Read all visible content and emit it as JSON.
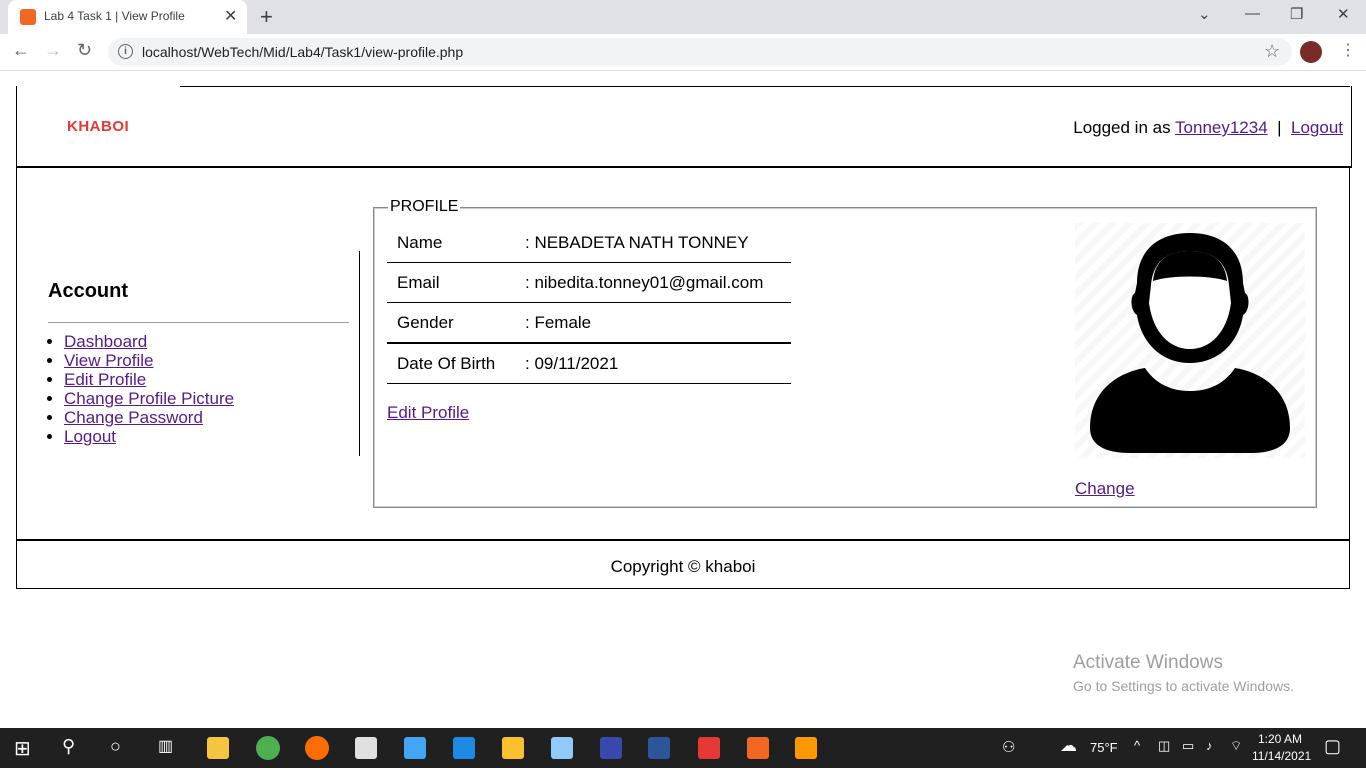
{
  "browser": {
    "tab_title": "Lab 4 Task 1 | View Profile",
    "url": "localhost/WebTech/Mid/Lab4/Task1/view-profile.php"
  },
  "header": {
    "logo": "KHABOI",
    "logged_in_prefix": "Logged in as",
    "username": "Tonney1234",
    "separator": "|",
    "logout": "Logout"
  },
  "sidebar": {
    "title": "Account",
    "items": [
      {
        "label": "Dashboard"
      },
      {
        "label": "View Profile"
      },
      {
        "label": "Edit Profile"
      },
      {
        "label": "Change Profile Picture"
      },
      {
        "label": "Change Password"
      },
      {
        "label": "Logout"
      }
    ]
  },
  "profile": {
    "legend": "PROFILE",
    "rows": [
      {
        "label": "Name",
        "value": ": NEBADETA NATH TONNEY"
      },
      {
        "label": "Email",
        "value": ": nibedita.tonney01@gmail.com"
      },
      {
        "label": "Gender",
        "value": ": Female"
      },
      {
        "label": "Date Of Birth",
        "value": ": 09/11/2021"
      }
    ],
    "edit_link": "Edit Profile",
    "change_link": "Change"
  },
  "footer": {
    "copyright": "Copyright © khaboi"
  },
  "watermark": {
    "line1": "Activate Windows",
    "line2": "Go to Settings to activate Windows."
  },
  "taskbar": {
    "weather": "75°F",
    "time": "1:20 AM",
    "date": "11/14/2021"
  },
  "colors": {
    "logo": "#e53935",
    "link": "#551a8b"
  }
}
